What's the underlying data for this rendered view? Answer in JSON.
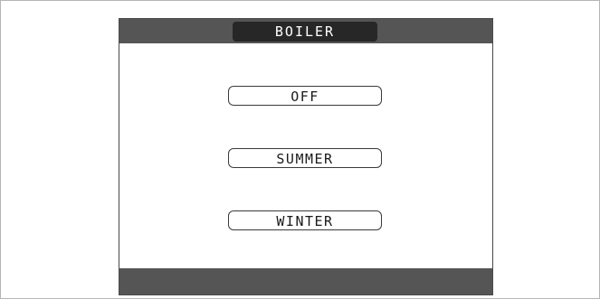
{
  "header": {
    "title": "BOILER"
  },
  "modes": [
    {
      "label": "OFF"
    },
    {
      "label": "SUMMER"
    },
    {
      "label": "WINTER"
    }
  ],
  "colors": {
    "bar": "#555555",
    "title_tab": "#272727",
    "screen_border": "#4a4a4a",
    "background": "#ffffff"
  }
}
